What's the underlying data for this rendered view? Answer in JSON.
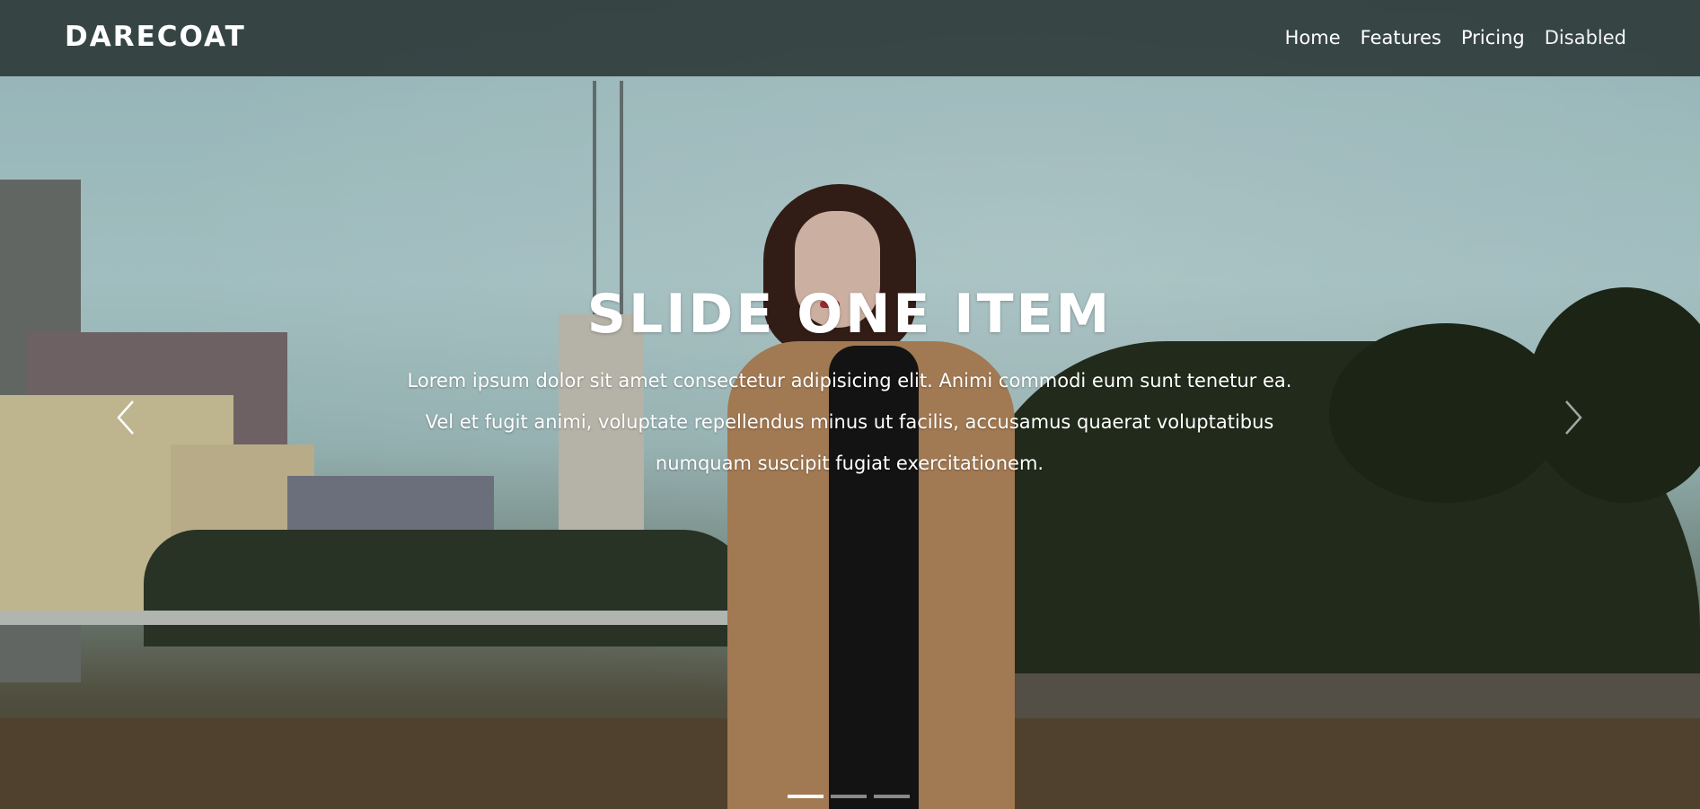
{
  "navbar": {
    "brand": "DARECOAT",
    "links": [
      {
        "label": "Home"
      },
      {
        "label": "Features"
      },
      {
        "label": "Pricing"
      },
      {
        "label": "Disabled"
      }
    ]
  },
  "slide": {
    "title": "SLIDE ONE ITEM",
    "text": "Lorem ipsum dolor sit amet consectetur adipisicing elit. Animi commodi eum sunt tenetur ea. Vel et fugit animi, voluptate repellendus minus ut facilis, accusamus quaerat voluptatibus numquam suscipit fugiat exercitationem."
  },
  "carousel": {
    "prev_icon": "chevron-left-icon",
    "next_icon": "chevron-right-icon",
    "slide_count": 3,
    "active_index": 0
  },
  "colors": {
    "navbar_bg": "#212c2b",
    "text": "#ffffff"
  }
}
